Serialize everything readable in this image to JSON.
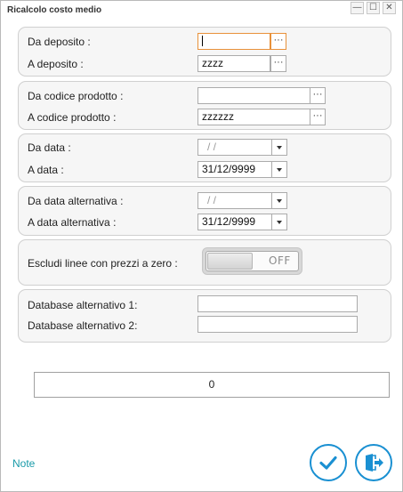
{
  "window": {
    "title": "Ricalcolo costo medio",
    "controls": {
      "minimize": "—",
      "maximize": "☐",
      "close": "✕"
    }
  },
  "deposito": {
    "from_label": "Da deposito :",
    "from_value": "",
    "to_label": "A deposito :",
    "to_value": "zzzz"
  },
  "prodotto": {
    "from_label": "Da codice prodotto :",
    "from_value": "",
    "to_label": "A codice prodotto :",
    "to_value": "zzzzzz"
  },
  "data": {
    "from_label": "Da data :",
    "from_value": "/ /",
    "to_label": "A data :",
    "to_value": "31/12/9999"
  },
  "data_alt": {
    "from_label": "Da data alternativa :",
    "from_value": "/ /",
    "to_label": "A data alternativa :",
    "to_value": "31/12/9999"
  },
  "escludi": {
    "label": "Escludi linee con prezzi a zero :",
    "toggle_text": "OFF",
    "toggle_on": false
  },
  "database": {
    "alt1_label": "Database alternativo 1:",
    "alt1_value": "",
    "alt2_label": "Database alternativo 2:",
    "alt2_value": ""
  },
  "result_value": "0",
  "footer": {
    "note_label": "Note",
    "ellipsis": "···"
  },
  "colors": {
    "accent": "#1a90d2",
    "note": "#1a9ba9",
    "focus": "#e8913a"
  },
  "icons": {
    "confirm": "check-icon",
    "exit": "exit-door-icon"
  }
}
